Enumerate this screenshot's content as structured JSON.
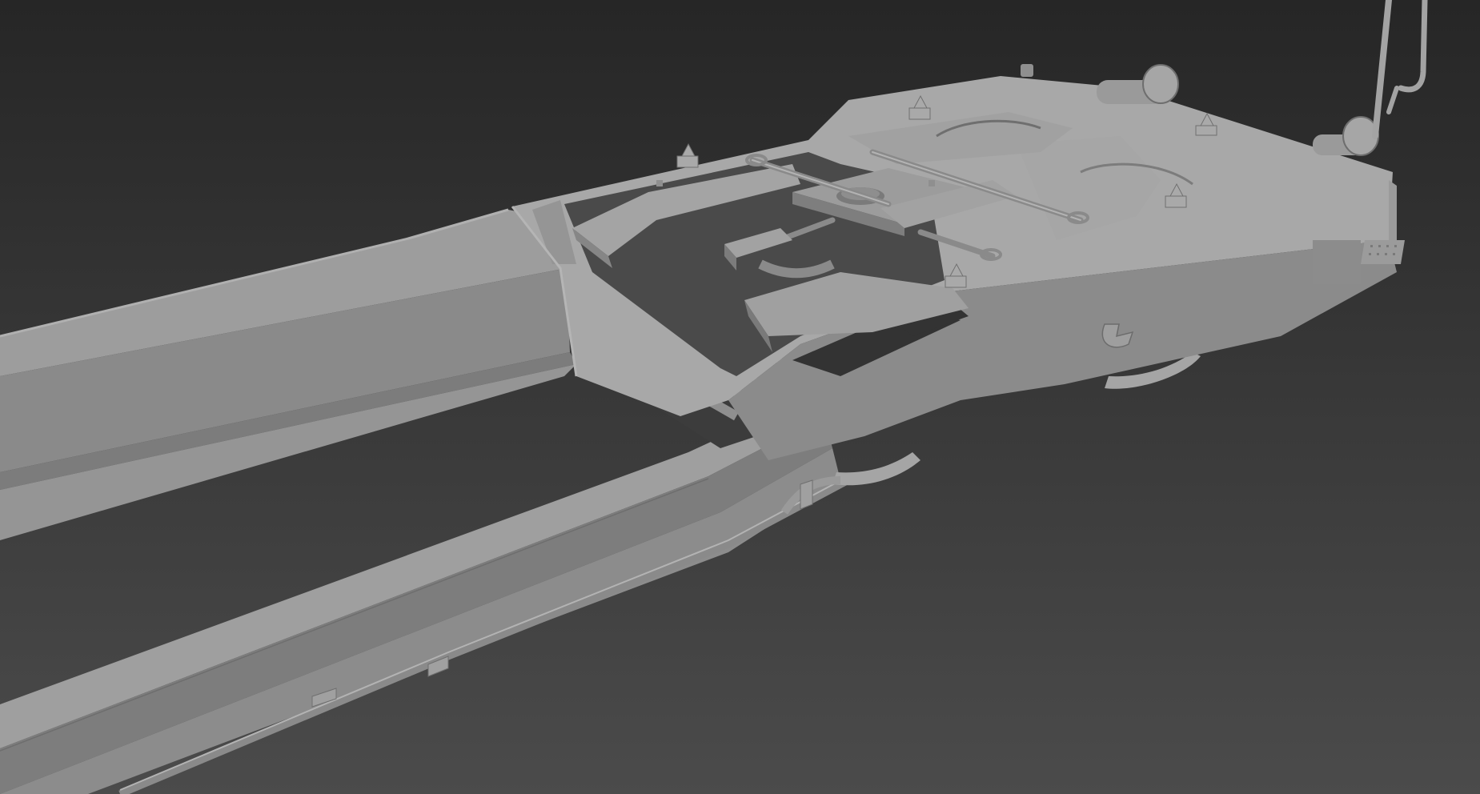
{
  "scene": {
    "subject": "3d-wagon-chassis-model",
    "background_top": "#272727",
    "background_bottom": "#4a4a4a",
    "material_light": "#a3a3a3",
    "material_mid": "#8e8e8e",
    "material_dark": "#6a6a6a",
    "material_shadow": "#4e4e4e"
  }
}
